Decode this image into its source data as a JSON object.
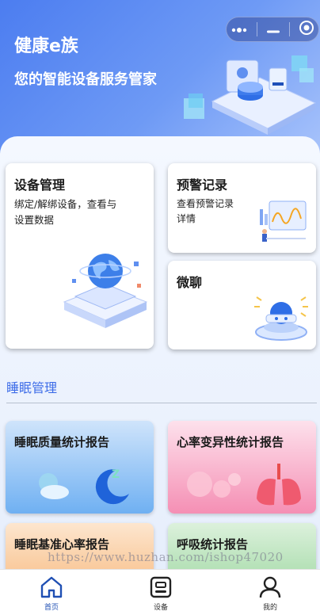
{
  "header": {
    "title": "健康e族",
    "subtitle": "您的智能设备服务管家"
  },
  "capsule": {
    "more_icon": "more-dots-icon",
    "minimize_icon": "minimize-icon",
    "close_icon": "target-close-icon"
  },
  "cards": {
    "device": {
      "title": "设备管理",
      "desc_line1": "绑定/解绑设备，查看与",
      "desc_line2": "设置数据"
    },
    "alert": {
      "title": "预警记录",
      "desc_line1": "查看预警记录",
      "desc_line2": "详情"
    },
    "chat": {
      "title": "微聊"
    }
  },
  "sleep_section": {
    "title": "睡眠管理",
    "reports": [
      {
        "title": "睡眠质量统计报告"
      },
      {
        "title": "心率变异性统计报告"
      },
      {
        "title": "睡眠基准心率报告"
      },
      {
        "title": "呼吸统计报告"
      }
    ]
  },
  "watermark": "https://www.huzhan.com/ishop47020",
  "tabbar": {
    "items": [
      {
        "label": "首页",
        "icon": "home-icon"
      },
      {
        "label": "设备",
        "icon": "device-icon"
      },
      {
        "label": "我的",
        "icon": "user-icon"
      }
    ],
    "active_color": "#1f4fb3"
  },
  "colors": {
    "brand_blue": "#4c7df0",
    "section_blue": "#3d6ce8",
    "sleep_card": "#6fb0f2",
    "hrv_card": "#f58fb4",
    "baseline_card": "#f8c08a",
    "breath_card": "#a6dba9"
  }
}
